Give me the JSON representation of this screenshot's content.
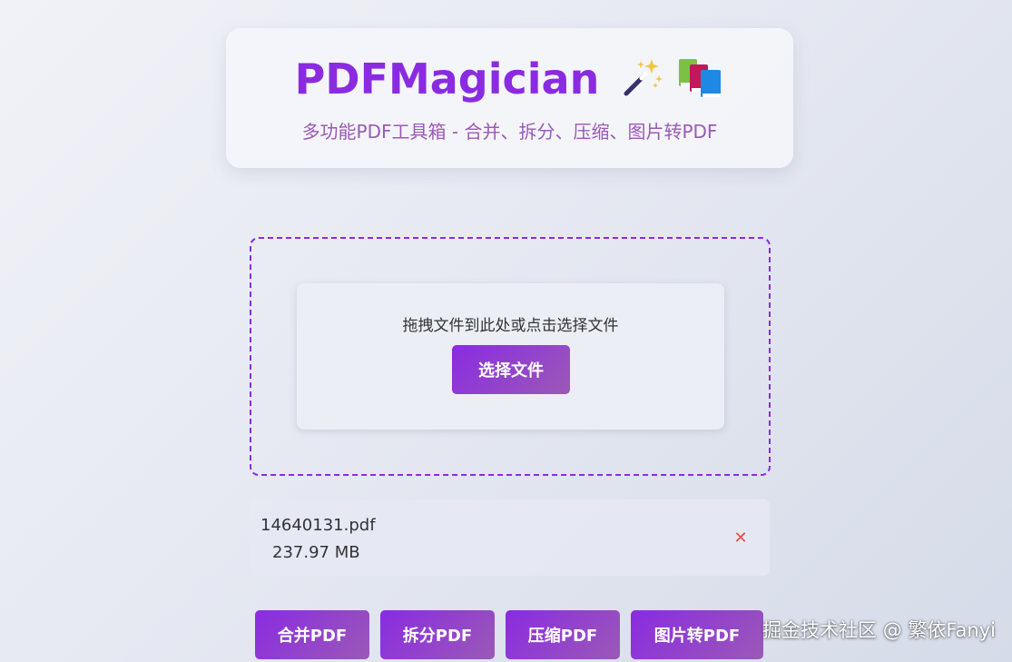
{
  "header": {
    "title": "PDFMagician",
    "title_emojis": [
      "🪄",
      "📚"
    ],
    "subtitle": "多功能PDF工具箱 - 合并、拆分、压缩、图片转PDF"
  },
  "upload": {
    "prompt": "拖拽文件到此处或点击选择文件",
    "choose_label": "选择文件"
  },
  "files": [
    {
      "name": "14640131.pdf",
      "size": "237.97 MB",
      "remove_icon": "✕"
    }
  ],
  "actions": [
    {
      "label": "合并PDF"
    },
    {
      "label": "拆分PDF"
    },
    {
      "label": "压缩PDF"
    },
    {
      "label": "图片转PDF"
    }
  ],
  "watermark": "掘金技术社区 @ 繁依Fanyi",
  "colors": {
    "accent": "#8a2be2",
    "accent_secondary": "#9b59b6",
    "danger": "#e74c3c"
  }
}
